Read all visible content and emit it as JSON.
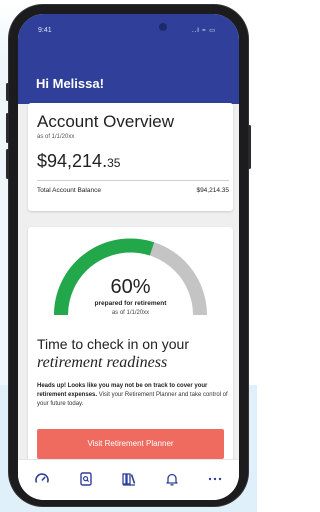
{
  "status": {
    "time": "9:41",
    "icons": "..l ≈ ▭"
  },
  "greeting": "Hi Melissa!",
  "overview": {
    "title": "Account Overview",
    "as_of": "as of 1/1/20xx",
    "amount_main": "$94,214.",
    "amount_cents": "35",
    "total_label": "Total Account Balance",
    "total_value": "$94,214.35"
  },
  "retirement": {
    "percent_value": 60,
    "percent_text": "60%",
    "prepared_label": "prepared for retirement",
    "as_of": "as of 1/1/20xx",
    "headline_1": "Time to check in on your",
    "headline_2": "retirement readiness",
    "message_bold": "Heads up! Looks like you may not be on track to cover your retirement expenses.",
    "message_rest": " Visit your Retirement Planner and take control of your future today.",
    "cta_label": "Visit Retirement Planner"
  },
  "tabs": [
    "gauge-icon",
    "document-search-icon",
    "library-icon",
    "bell-icon",
    "more-icon"
  ],
  "colors": {
    "header": "#2f3f9a",
    "gauge_progress": "#22a84a",
    "gauge_track": "#c4c4c4",
    "cta": "#ef6b5f",
    "tab_icon": "#2f3f9a"
  }
}
